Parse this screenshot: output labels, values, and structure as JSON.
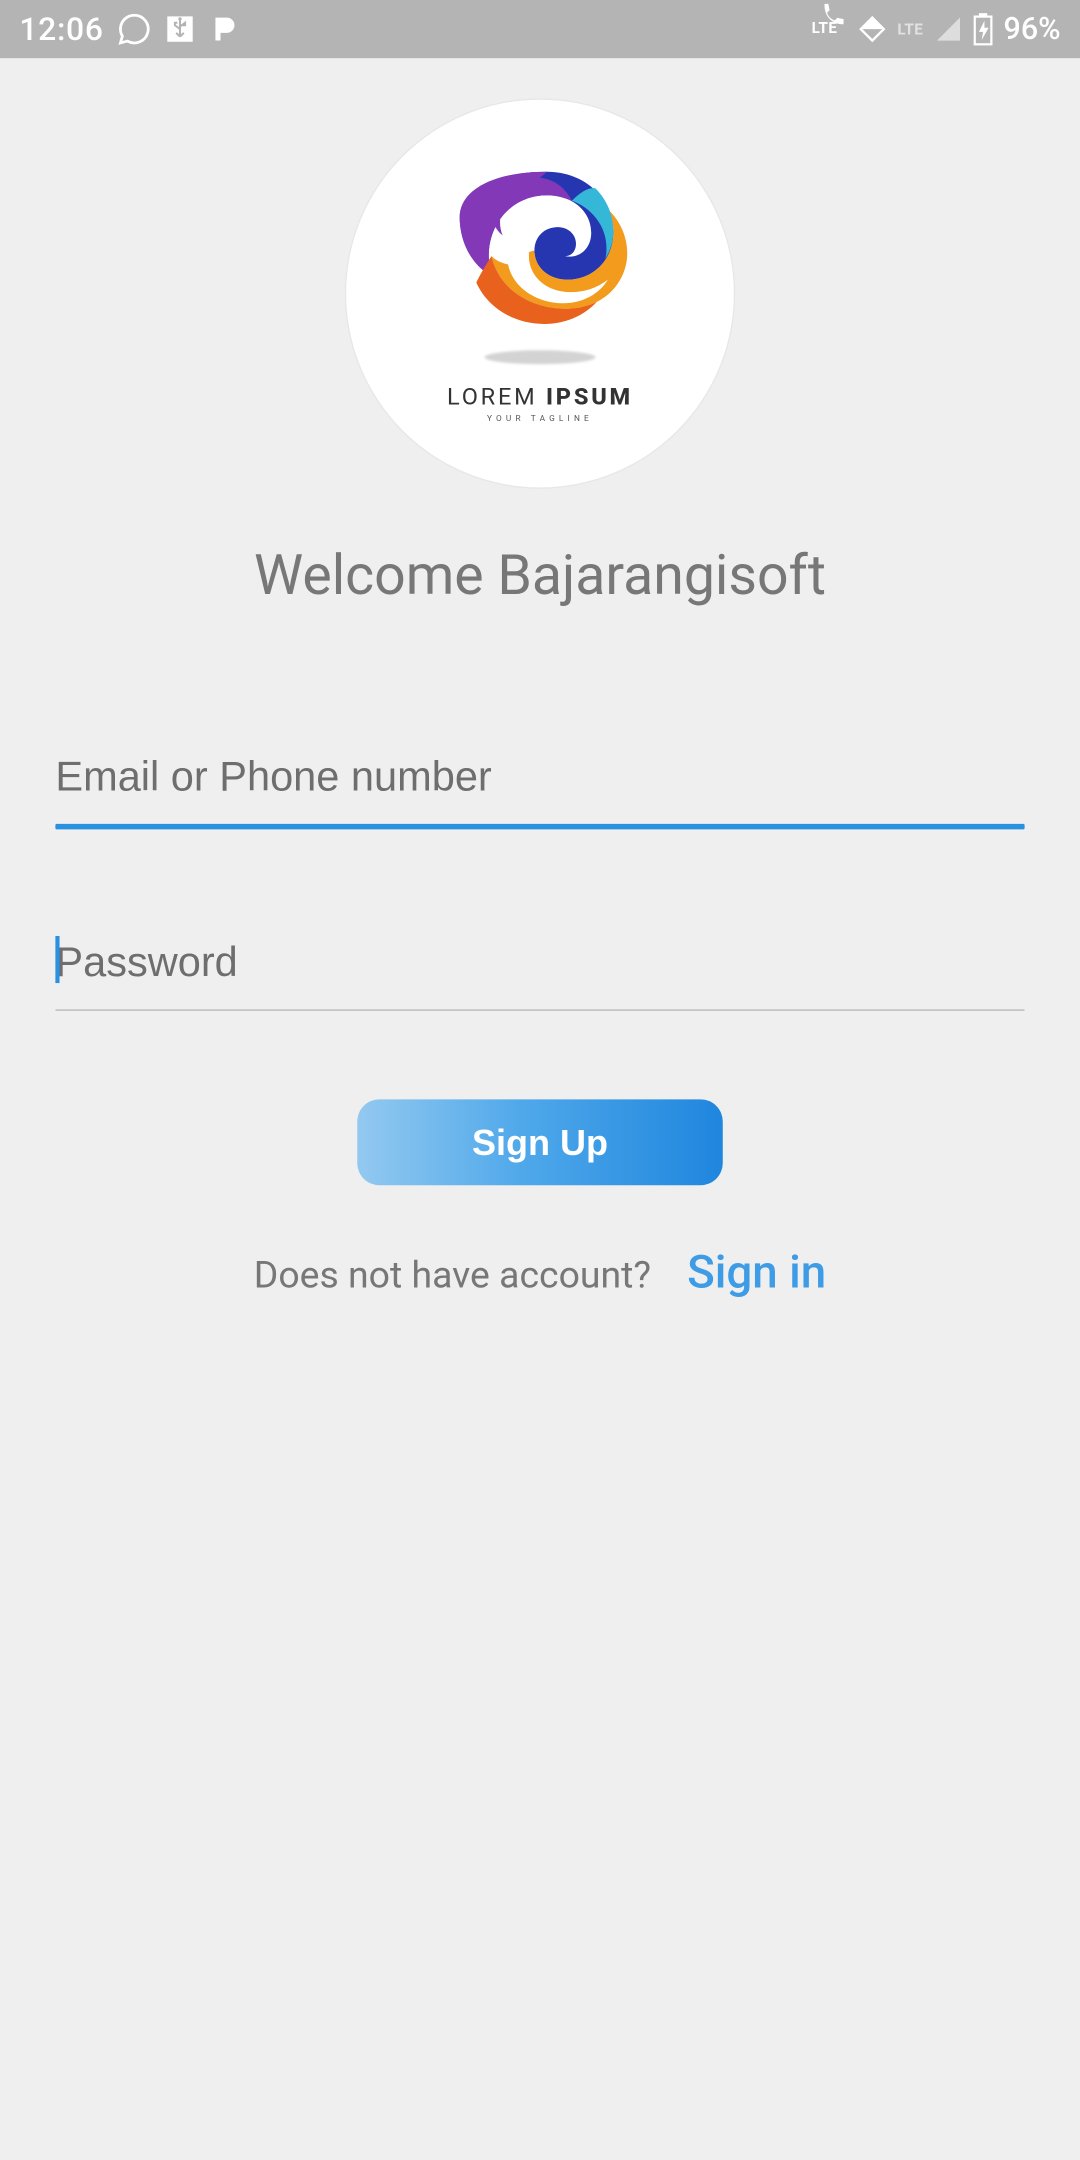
{
  "status": {
    "time": "12:06",
    "battery": "96%"
  },
  "logo": {
    "line1a": "LOREM ",
    "line1b": "IPSUM",
    "tagline": "YOUR TAGLINE"
  },
  "header": {
    "welcome": "Welcome Bajarangisoft"
  },
  "form": {
    "email_placeholder": "Email or Phone number",
    "password_placeholder": "Password",
    "signup_label": "Sign Up"
  },
  "footer": {
    "prompt": "Does not have account?",
    "signin_label": "Sign in"
  }
}
